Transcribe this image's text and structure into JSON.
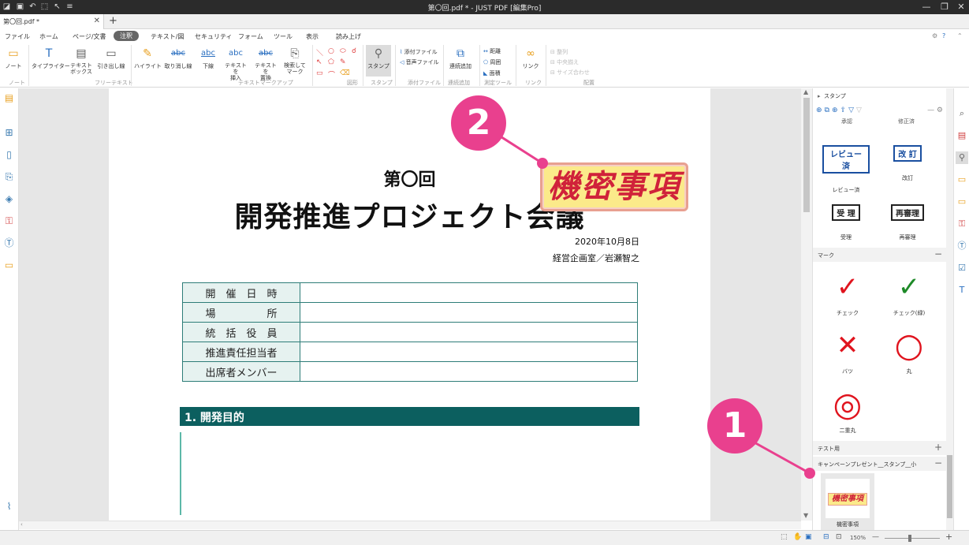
{
  "titlebar": {
    "title": "第〇回.pdf * - JUST PDF [編集Pro]",
    "minimize": "—",
    "maximize": "❐",
    "close": "✕"
  },
  "tabs": {
    "doc_tab": "第〇回.pdf *",
    "close": "✕",
    "new": "+"
  },
  "menu": {
    "items": [
      "ファイル",
      "ホーム",
      "ページ/文書",
      "注釈",
      "テキスト/図",
      "セキュリティ",
      "フォーム",
      "ツール",
      "表示",
      "読み上げ"
    ],
    "active": "注釈"
  },
  "ribbon": {
    "note": "ノート",
    "note_group": "ノート",
    "typewriter": "タイプライター",
    "textbox": "テキスト\nボックス",
    "callout": "引き出し線",
    "freetext_group": "フリーテキスト",
    "highlight": "ハイライト",
    "strike": "取り消し線",
    "underline": "下線",
    "insert": "テキストを\n挿入",
    "replace": "テキストを\n置換",
    "search_mark": "検索して\nマーク",
    "markup_group": "テキストマークアップ",
    "shape_group": "図形",
    "stamp": "スタンプ",
    "stamp_group": "スタンプ",
    "attach_file": "添付ファイル",
    "audio_file": "音声ファイル",
    "attach_group": "添付ファイル",
    "continuous": "連続追加",
    "continuous_group": "連続追加",
    "distance": "距離",
    "perimeter": "周囲",
    "area": "面積",
    "measure_group": "測定ツール",
    "link": "リンク",
    "link_group": "リンク",
    "align": "整列",
    "center": "中央揃え",
    "size": "サイズ合わせ",
    "arrange_group": "配置",
    "abc": "abc"
  },
  "document": {
    "heading_small": "第〇回",
    "heading_main": "開発推進プロジェクト会議",
    "date": "2020年10月8日",
    "author": "経営企画室／岩瀬智之",
    "table_rows": [
      "開　催　日　時",
      "場　　　　　所",
      "統　括　役　員",
      "推進責任担当者",
      "出席者メンバー"
    ],
    "section_title": "1. 開発目的",
    "stamp_text": "機密事項"
  },
  "panel": {
    "title": "スタンプ",
    "cut_labels": [
      "承認",
      "修正済"
    ],
    "top_stamps": [
      {
        "text": "レビュー済",
        "label": "レビュー済"
      },
      {
        "text": "改 訂",
        "label": "改訂"
      },
      {
        "text": "受 理",
        "label": "受理"
      },
      {
        "text": "再審理",
        "label": "再審理"
      }
    ],
    "marks_title": "マーク",
    "marks": [
      {
        "glyph": "✓",
        "label": "チェック",
        "color": "#e0141e"
      },
      {
        "glyph": "✓",
        "label": "チェック(緑)",
        "color": "#1e8a28"
      },
      {
        "glyph": "✕",
        "label": "バツ",
        "color": "#e0141e"
      },
      {
        "glyph": "○",
        "label": "丸",
        "color": "#e0141e"
      },
      {
        "glyph": "◎",
        "label": "二重丸",
        "color": "#e0141e"
      }
    ],
    "test_group": "テスト用",
    "campaign_group": "キャンペーンプレゼント__スタンプ__小",
    "campaign_item_label": "機密事項",
    "campaign_item_text": "機密事項"
  },
  "status": {
    "zoom": "150%",
    "minus": "—",
    "plus": "+"
  },
  "callouts": {
    "one": "1",
    "two": "2"
  },
  "colors": {
    "accent_pink": "#e9408e",
    "section_teal": "#0c5f5f",
    "table_border": "#2e7d78",
    "stamp_red": "#d0223a"
  }
}
